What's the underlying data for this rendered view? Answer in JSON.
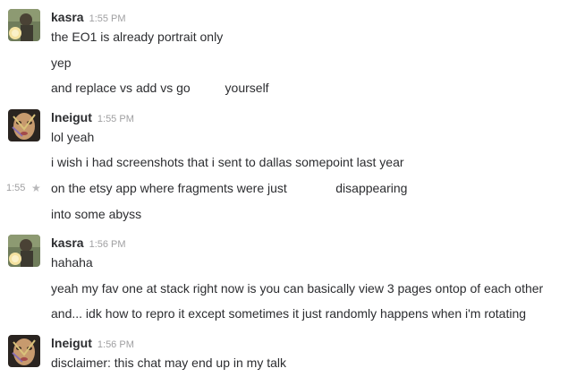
{
  "messages": [
    {
      "author": "kasra",
      "time": "1:55 PM",
      "avatar": "kasra-avatar",
      "lines": [
        "the EO1 is already portrait only",
        "yep",
        "and replace vs add vs go          yourself"
      ]
    },
    {
      "author": "lneigut",
      "time": "1:55 PM",
      "avatar": "lneigut-avatar",
      "lines": [
        "lol yeah",
        "i wish i had screenshots that i sent to dallas somepoint last year",
        "on the etsy app where fragments were just              disappearing",
        "into some abyss"
      ],
      "hover_time": "1:55"
    },
    {
      "author": "kasra",
      "time": "1:56 PM",
      "avatar": "kasra-avatar",
      "lines": [
        "hahaha",
        "yeah my fav one at stack right now is you can basically view 3 pages ontop of each other",
        "and... idk how to repro it except sometimes it just randomly happens when i'm rotating"
      ]
    },
    {
      "author": "lneigut",
      "time": "1:56 PM",
      "avatar": "lneigut-avatar",
      "lines": [
        "disclaimer: this chat may end up in my talk"
      ]
    }
  ],
  "colors": {
    "text": "#2c2d30",
    "muted": "#a0a0a2",
    "star": "#b8b8ba"
  }
}
